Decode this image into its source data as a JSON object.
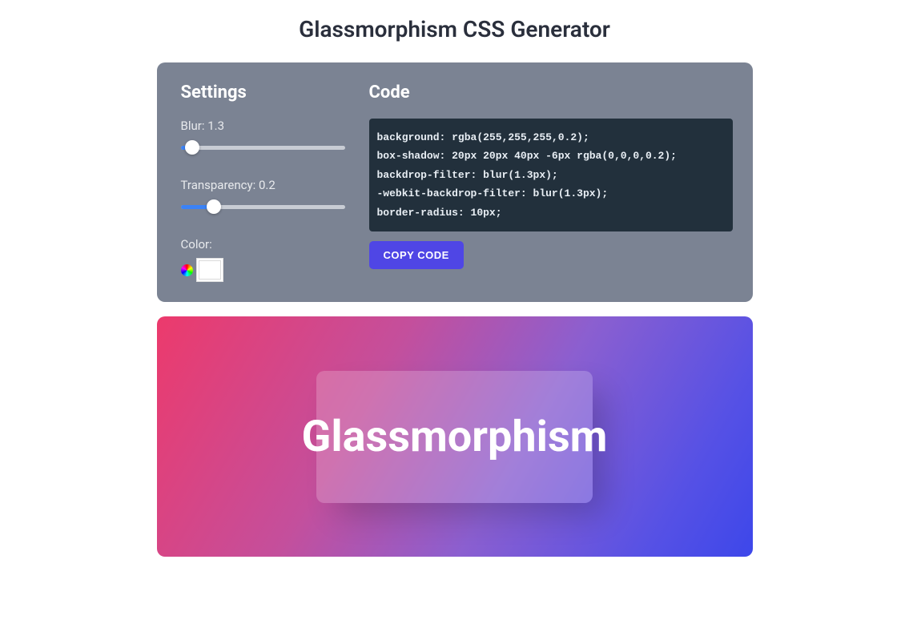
{
  "title": "Glassmorphism CSS Generator",
  "settings": {
    "heading": "Settings",
    "blur": {
      "label": "Blur: 1.3",
      "value": 1.3,
      "percent": 7
    },
    "transparency": {
      "label": "Transparency: 0.2",
      "value": 0.2,
      "percent": 20
    },
    "color": {
      "label": "Color:",
      "value": "#ffffff"
    }
  },
  "code": {
    "heading": "Code",
    "lines": "background: rgba(255,255,255,0.2);\nbox-shadow: 20px 20px 40px -6px rgba(0,0,0,0.2);\nbackdrop-filter: blur(1.3px);\n-webkit-backdrop-filter: blur(1.3px);\nborder-radius: 10px;",
    "copy_button": "COPY CODE"
  },
  "preview": {
    "text": "Glassmorphism"
  }
}
